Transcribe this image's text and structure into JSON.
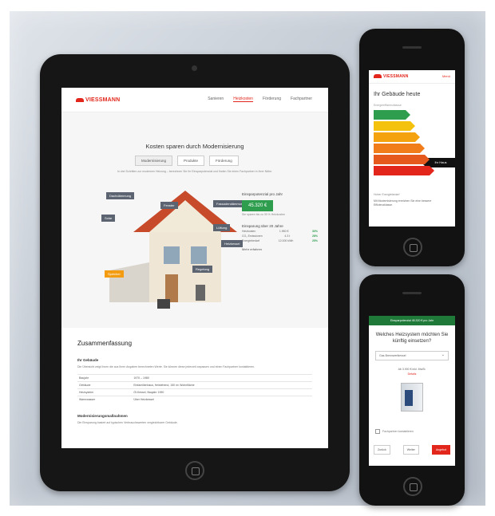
{
  "brand": {
    "logo": "VIESSMANN",
    "accent": "#e2261b",
    "green": "#2e9e4e"
  },
  "tablet": {
    "nav": [
      "Sanieren",
      "Heizkosten",
      "Förderung",
      "Fachpartner"
    ],
    "title": "Kosten sparen durch Modernisierung",
    "tabs": [
      "Modernisierung",
      "Produkte",
      "Förderung"
    ],
    "description": "In drei Schritten zur modernen Heizung – berechnen Sie Ihr Einsparpotenzial und finden Sie einen Fachpartner in Ihrer Nähe.",
    "house_labels": [
      "Dachdämmung",
      "Fenster",
      "Fassadendämmung",
      "Solar",
      "Lüftung",
      "Heizkessel",
      "Speicher",
      "Regelung"
    ],
    "savings": {
      "label": "Einsparpotenzial pro Jahr",
      "value": "45.320 €",
      "note": "Sie sparen bis zu 30 % Heizkosten",
      "sub": "Einsparung über 20 Jahre",
      "rows": [
        {
          "k": "Heizkosten",
          "v": "1.950 €",
          "p": "30%"
        },
        {
          "k": "CO₂ Emissionen",
          "v": "4.3 t",
          "p": "28%"
        },
        {
          "k": "Energiebedarf",
          "v": "12.000 kWh",
          "p": "25%"
        }
      ],
      "more": "Mehr erfahren"
    },
    "section_title": "Zusammenfassung",
    "subhead": "Ihr Gebäude",
    "paragraph": "Die Übersicht zeigt Ihnen die aus Ihren Angaben berechneten Werte. Sie können diese jederzeit anpassen und einen Fachpartner kontaktieren.",
    "table": [
      {
        "k": "Baujahr",
        "v": "1970 – 1980"
      },
      {
        "k": "Gebäude",
        "v": "Einfamilienhaus, freistehend, 150 m² Wohnfläche"
      },
      {
        "k": "Heizsystem",
        "v": "Öl-Kessel, Baujahr 1990"
      },
      {
        "k": "Warmwasser",
        "v": "Über Heizkessel"
      }
    ],
    "subhead2": "Modernisierungsmaßnahmen",
    "paragraph2": "Die Einsparung basiert auf typischen Verbrauchswerten vergleichbarer Gebäude."
  },
  "phone1": {
    "menu": "Menü",
    "title": "Ihr Gebäude heute",
    "sub": "Energieeffizienzklasse",
    "bars": [
      {
        "color": "#2e9e4e",
        "w": 40
      },
      {
        "color": "#f4c20d",
        "w": 46
      },
      {
        "color": "#f4a20d",
        "w": 52
      },
      {
        "color": "#f07c1a",
        "w": 58
      },
      {
        "color": "#e55a1c",
        "w": 64
      },
      {
        "color": "#e2261b",
        "w": 70
      }
    ],
    "marker": "Ihr Haus",
    "small": "Hoher Energiebedarf",
    "foot": "Mit Modernisierung erreichen Sie eine bessere Effizienzklasse."
  },
  "phone2": {
    "header": "Einsparpotenzial 45.320 € pro Jahr",
    "question": "Welches Heizsystem möchten Sie künftig einsetzen?",
    "select": "Gas-Brennwertkessel",
    "price": "Ab 3.900 € inkl. MwSt.",
    "price_link": "Details",
    "check": "Fachpartner kontaktieren",
    "actions": [
      "Zurück",
      "Weiter",
      "Angebot"
    ]
  }
}
